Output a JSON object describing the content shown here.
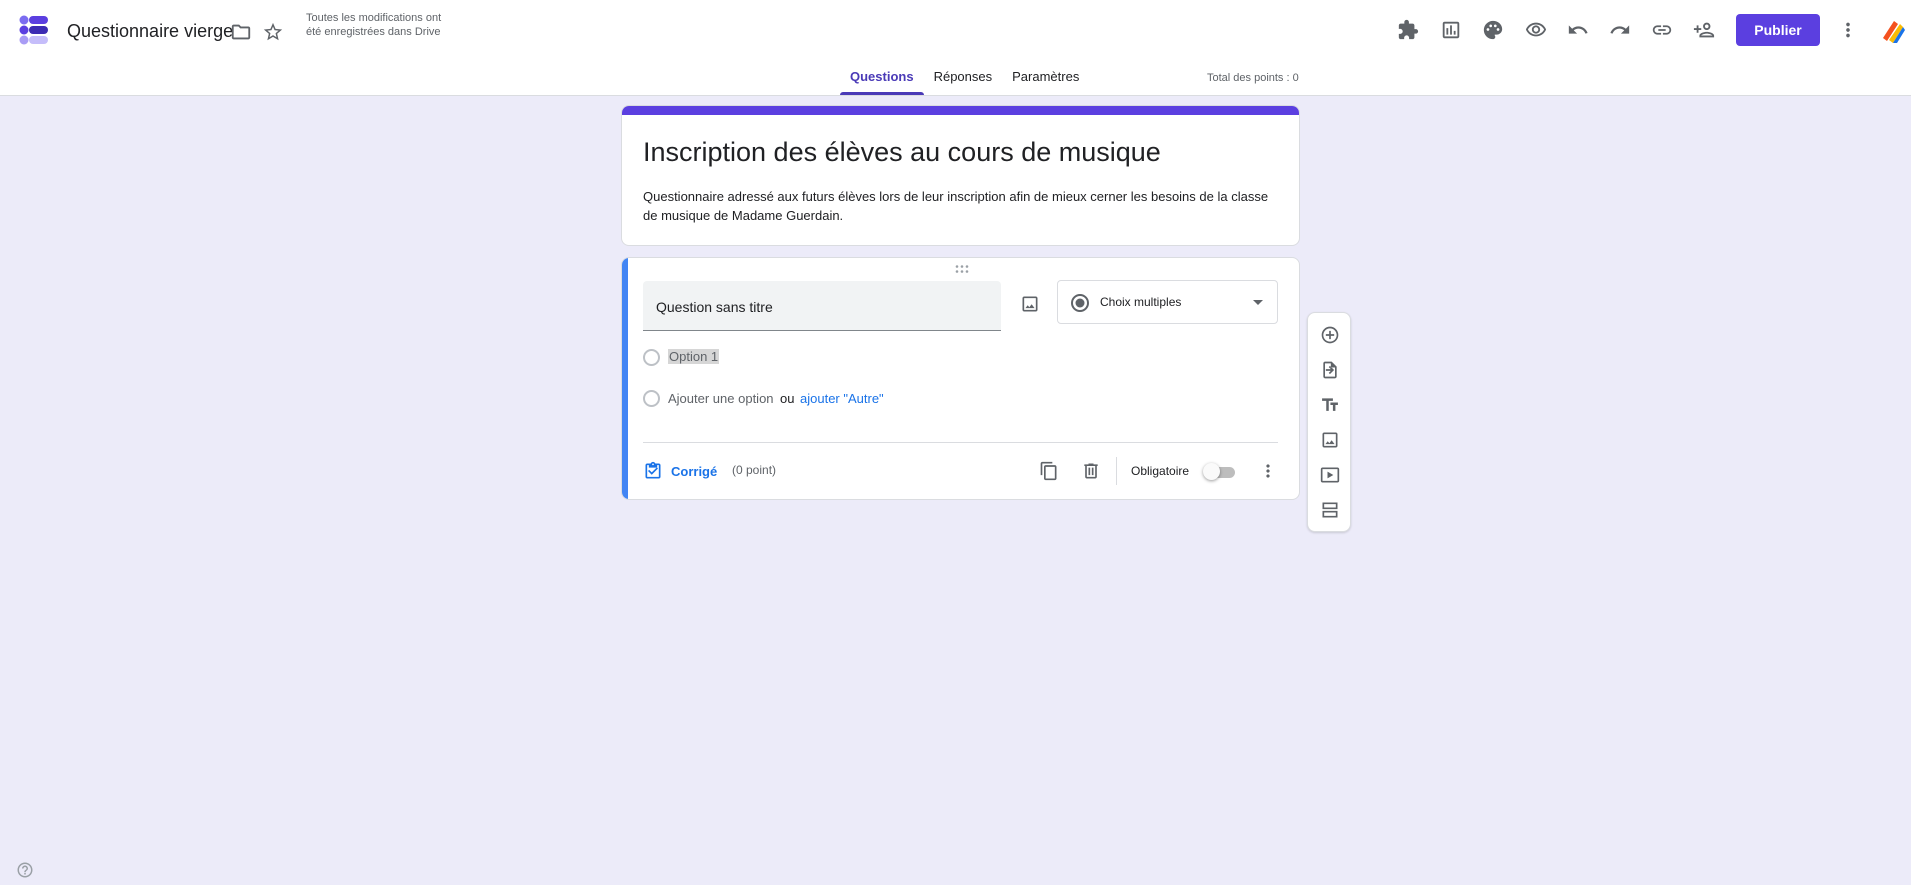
{
  "header": {
    "doc_title": "Questionnaire vierge",
    "save_status": "Toutes les modifications ont été enregistrées dans Drive",
    "publish_label": "Publier",
    "icons": [
      "move-to-folder-icon",
      "star-icon",
      "addons-icon",
      "form-template-icon",
      "palette-icon",
      "preview-icon",
      "undo-icon",
      "redo-icon",
      "link-icon",
      "add-collaborator-icon",
      "more-vert-icon"
    ]
  },
  "tabs": [
    {
      "label": "Questions",
      "active": true
    },
    {
      "label": "Réponses",
      "active": false
    },
    {
      "label": "Paramètres",
      "active": false
    }
  ],
  "total_points": "Total des points : 0",
  "form": {
    "title": "Inscription des élèves au cours de musique",
    "description": "Questionnaire adressé aux futurs élèves lors de leur inscription afin de mieux cerner les besoins de la classe de musique de Madame Guerdain."
  },
  "question": {
    "title": "Question sans titre",
    "type": "Choix multiples",
    "options": [
      "Option 1"
    ],
    "add_option": "Ajouter une option",
    "or": "ou",
    "add_other": "ajouter \"Autre\"",
    "answer_key": "Corrigé",
    "points": "(0 point)",
    "required_label": "Obligatoire",
    "required": false
  },
  "toolbar": [
    "add-question-icon",
    "import-questions-icon",
    "add-title-icon",
    "add-image-icon",
    "add-video-icon",
    "add-section-icon"
  ],
  "colors": {
    "accent": "#5b3fe0",
    "question_accent": "#4285f4",
    "link": "#1a73e8",
    "background": "#ecebf9"
  }
}
